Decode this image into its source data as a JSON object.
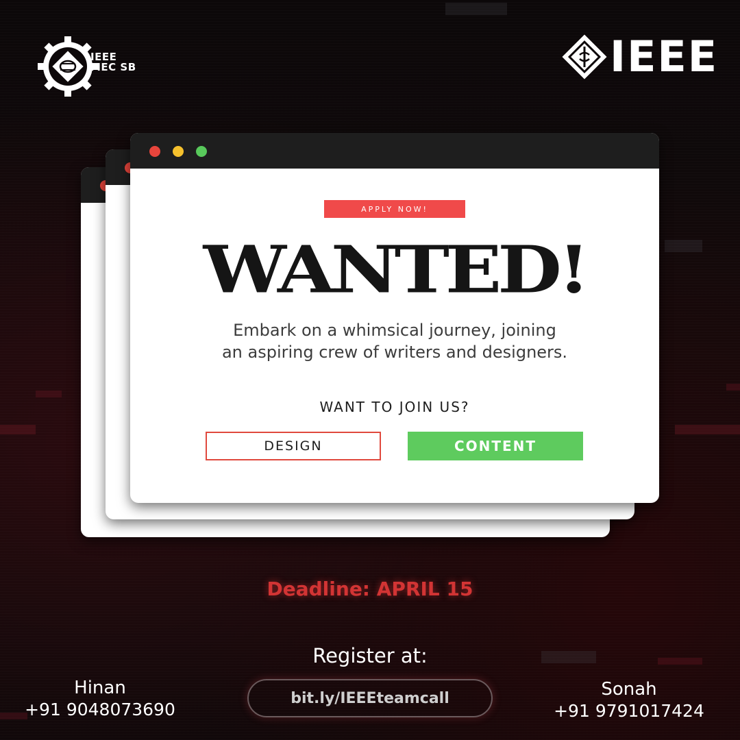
{
  "brand": {
    "sb_logo_text_line1": "IEEE",
    "sb_logo_text_line2": "MEC SB",
    "ieee_wordmark": "IEEE"
  },
  "window": {
    "badge": "APPLY NOW!",
    "headline": "WANTED!",
    "tagline_line1": "Embark on a whimsical journey, joining",
    "tagline_line2": "an aspiring crew of writers and designers.",
    "question": "WANT TO JOIN US?",
    "design_button": "DESIGN",
    "content_button": "CONTENT"
  },
  "footer": {
    "deadline": "Deadline: APRIL 15",
    "register_label": "Register at:",
    "register_link": "bit.ly/IEEEteamcall",
    "contacts": [
      {
        "name": "Hinan",
        "phone": "+91 9048073690"
      },
      {
        "name": "Sonah",
        "phone": "+91 9791017424"
      }
    ]
  },
  "colors": {
    "accent_red": "#f04a4a",
    "accent_green": "#5ecb5e",
    "deadline_red": "#d23434",
    "window_bar": "#1e1e1e"
  }
}
